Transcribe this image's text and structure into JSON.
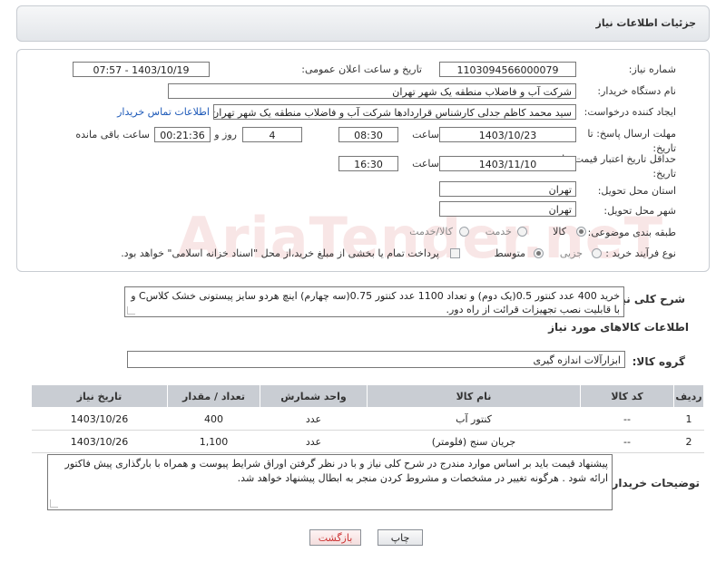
{
  "page": {
    "title": "جزئیات اطلاعات نیاز"
  },
  "form": {
    "need_number_label": "شماره نیاز:",
    "need_number": "1103094566000079",
    "announce_label": "تاریخ و ساعت اعلان عمومی:",
    "announce_value": "1403/10/19 - 07:57",
    "buyer_org_label": "نام دستگاه خریدار:",
    "buyer_org": "شرکت آب و فاضلاب منطقه یک شهر تهران",
    "creator_label": "ایجاد کننده درخواست:",
    "creator": "سید محمد کاظم جدلی کارشناس قراردادها شرکت آب و فاضلاب منطقه یک شهر تهران",
    "contact_link": "اطلاعات تماس خریدار",
    "deadline_label": "مهلت ارسال پاسخ: تا تاریخ:",
    "deadline_date": "1403/10/23",
    "time_label": "ساعت",
    "deadline_time": "08:30",
    "days_value": "4",
    "days_label": "روز و",
    "remaining_time": "00:21:36",
    "remaining_label": "ساعت باقی مانده",
    "validity_label": "حداقل تاریخ اعتبار قیمت: تا تاریخ:",
    "validity_date": "1403/11/10",
    "validity_time": "16:30",
    "province_label": "استان محل تحویل:",
    "province": "تهران",
    "city_label": "شهر محل تحویل:",
    "city": "تهران",
    "category_label": "طبقه بندی موضوعی:",
    "category_options": [
      "کالا",
      "خدمت",
      "کالا/خدمت"
    ],
    "process_label": "نوع فرآیند خرید :",
    "process_options": [
      "جزیی",
      "متوسط"
    ],
    "payment_note": "پرداخت تمام یا بخشی از مبلغ خرید،از محل \"اسناد خزانه اسلامی\" خواهد بود."
  },
  "summary": {
    "label": "شرح کلی نیاز:",
    "text": "خرید 400 عدد کنتور 0.5(یک دوم) و تعداد 1100 عدد کنتور 0.75(سه چهارم) اینچ هردو سایز پیستونی خشک کلاسC و با قابلیت نصب تجهیزات قرائت از راه دور."
  },
  "goods": {
    "section_title": "اطلاعات کالاهای مورد نیاز",
    "group_label": "گروه کالا:",
    "group_value": "ابزارآلات اندازه گیری",
    "columns": [
      "ردیف",
      "کد کالا",
      "نام کالا",
      "واحد شمارش",
      "تعداد / مقدار",
      "تاریخ نیاز"
    ],
    "rows": [
      [
        "1",
        "--",
        "کنتور آب",
        "عدد",
        "400",
        "1403/10/26"
      ],
      [
        "2",
        "--",
        "جریان سنج (فلومتر)",
        "عدد",
        "1,100",
        "1403/10/26"
      ]
    ]
  },
  "buyer_notes": {
    "label": "توضیحات خریدار:",
    "text": "پیشنهاد قیمت باید بر اساس موارد مندرج در شرح کلی نیاز و با در نظر گرفتن اوراق شرایط پیوست و همراه با بارگذاری پیش فاکتور ارائه شود . هرگونه تغییر در مشخصات و مشروط کردن منجر به ابطال پیشنهاد خواهد شد."
  },
  "buttons": {
    "print": "چاپ",
    "back": "بازگشت"
  },
  "watermark": "AriaTender.neT"
}
